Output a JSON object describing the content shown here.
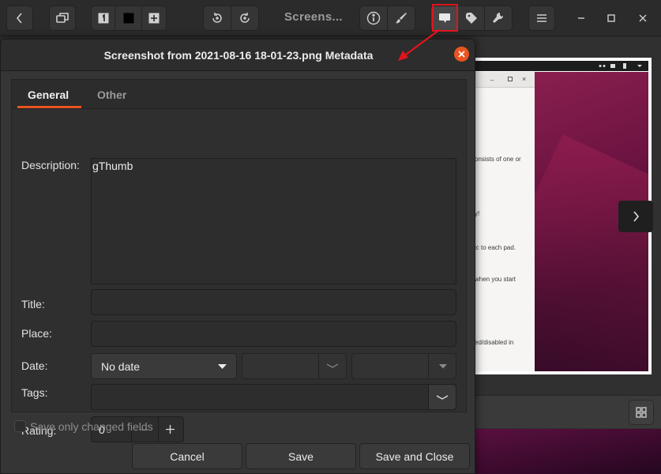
{
  "toolbar": {
    "title": "Screens...",
    "buttons": [
      "back",
      "browser-mode",
      "view-single",
      "view-thumbnails",
      "add-to-catalog",
      "rotate-left",
      "rotate-right",
      "properties",
      "edit",
      "comment",
      "tags",
      "tools",
      "menu"
    ]
  },
  "dialog": {
    "title": "Screenshot from 2021-08-16 18-01-23.png Metadata",
    "tabs": [
      {
        "label": "General",
        "active": true
      },
      {
        "label": "Other",
        "active": false
      }
    ],
    "fields": {
      "description_label": "Description:",
      "description_value": "gThumb",
      "title_label": "Title:",
      "title_value": "",
      "place_label": "Place:",
      "place_value": "",
      "date_label": "Date:",
      "date_option": "No date",
      "tags_label": "Tags:",
      "tags_value": "",
      "rating_label": "Rating:",
      "rating_value": "0"
    },
    "checkbox": {
      "label": "Save only changed fields",
      "checked": false
    },
    "buttons": {
      "cancel": "Cancel",
      "save": "Save",
      "save_close": "Save and Close"
    }
  },
  "preview": {
    "snippets": [
      "onsists of one or",
      "y!",
      "ic to each pad.",
      "when you start",
      "ed/disabled in"
    ]
  },
  "colors": {
    "accent": "#e95420",
    "annotation": "#e2141c",
    "background": "#2c2c2c"
  }
}
